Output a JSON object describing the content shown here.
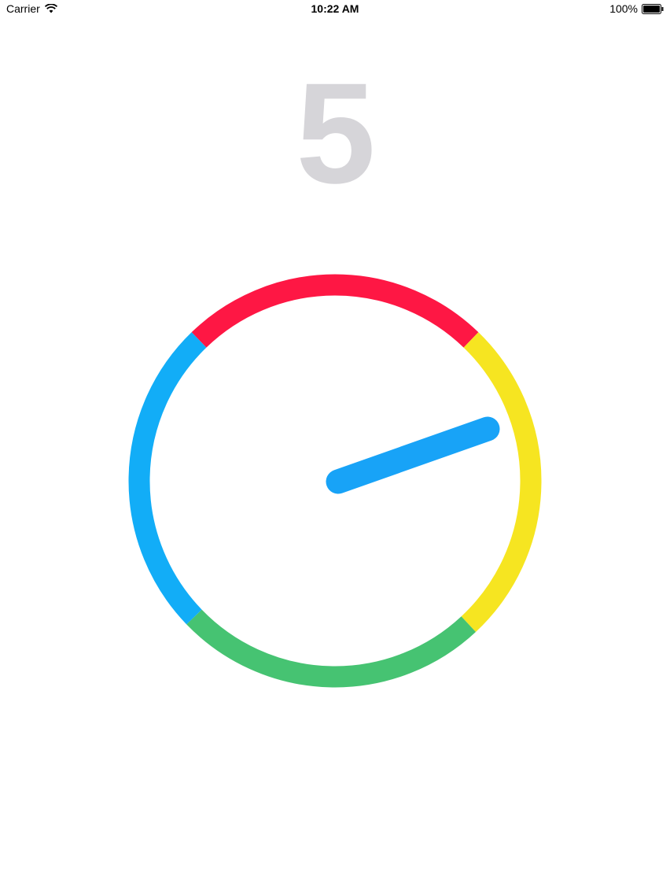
{
  "status_bar": {
    "carrier": "Carrier",
    "time": "10:22 AM",
    "battery": "100%",
    "icons": [
      "wifi-icon",
      "battery-icon"
    ]
  },
  "game": {
    "score": "5",
    "score_color": "#d6d5d9",
    "ring_segments": [
      {
        "name": "red",
        "color": "#fe1744"
      },
      {
        "name": "yellow",
        "color": "#f6e521"
      },
      {
        "name": "green",
        "color": "#46c372"
      },
      {
        "name": "blue",
        "color": "#12adf7"
      }
    ],
    "needle_color": "#18a3f7"
  }
}
